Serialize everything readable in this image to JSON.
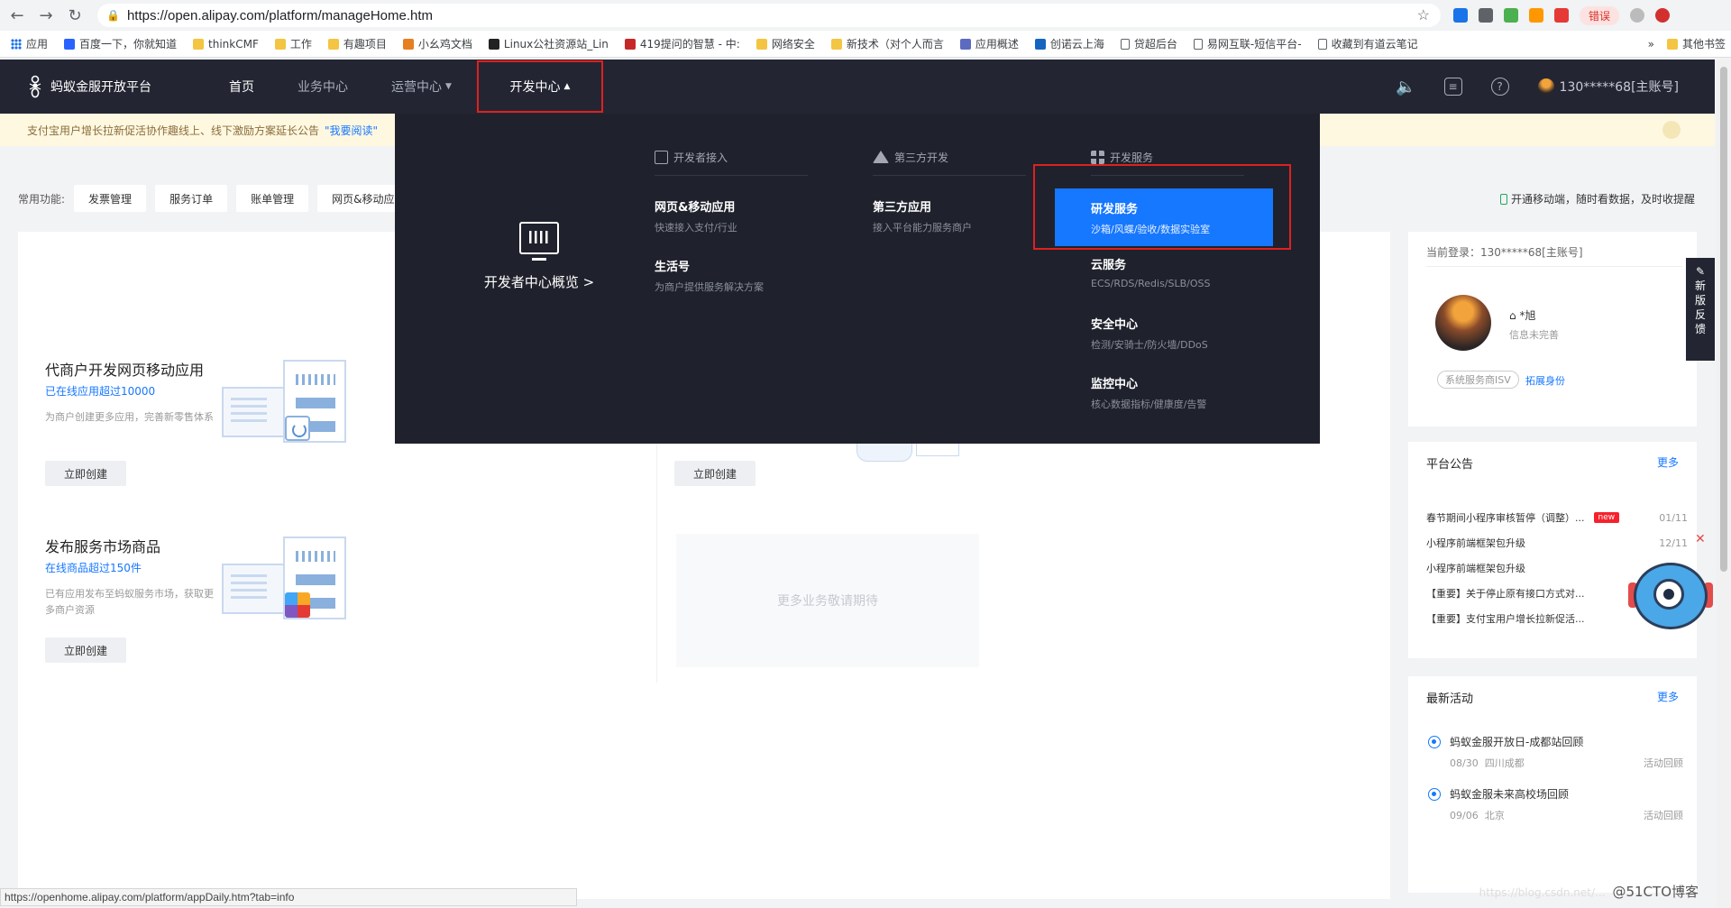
{
  "browser": {
    "url": "https://open.alipay.com/platform/manageHome.htm",
    "bookmarks": [
      "应用",
      "百度一下，你就知道",
      "thinkCMF",
      "工作",
      "有趣项目",
      "小幺鸡文档",
      "Linux公社资源站_Lin",
      "419提问的智慧 - 中:",
      "网络安全",
      "新技术（对个人而言",
      "应用概述",
      "创诺云上海",
      "贷超后台",
      "易网互联-短信平台-",
      "收藏到有道云笔记"
    ],
    "more_bookmarks": "其他书签",
    "error_badge": "错误",
    "status_url": "https://openhome.alipay.com/platform/appDaily.htm?tab=info"
  },
  "header": {
    "logo_text": "蚂蚁金服开放平台",
    "nav": [
      "首页",
      "业务中心",
      "运营中心",
      "开发中心"
    ],
    "account": "130*****68[主账号]"
  },
  "notice": {
    "text": "支付宝用户增长拉新促活协作趣线上、线下激励方案延长公告",
    "link": "\"我要阅读\""
  },
  "quick": {
    "label": "常用功能:",
    "items": [
      "发票管理",
      "服务订单",
      "账单管理",
      "网页&移动应用开"
    ]
  },
  "mobile_tip": "开通移动端，随时看数据，及时收提醒",
  "biz": [
    {
      "title": "代商户开发网页移动应用",
      "sub": "已在线应用超过10000",
      "desc": "为商户创建更多应用，完善新零售体系",
      "btn": "立即创建"
    },
    {
      "title": "发布服务市场商品",
      "sub": "在线商品超过150件",
      "desc": "已有应用发布至蚂蚁服务市场，获取更多商户资源",
      "btn": "立即创建"
    }
  ],
  "middle_btn": "立即创建",
  "coming_soon": "更多业务敬请期待",
  "user": {
    "login": "当前登录：130*****68[主账号]",
    "name": "*旭",
    "info": "信息未完善",
    "tag": "系统服务商ISV",
    "expand": "拓展身份"
  },
  "announce": {
    "title": "平台公告",
    "more": "更多",
    "items": [
      {
        "text": "春节期间小程序审核暂停（调整）...",
        "new": "new",
        "date": "01/11"
      },
      {
        "text": "小程序前端框架包升级",
        "new": "",
        "date": "12/11"
      },
      {
        "text": "小程序前端框架包升级",
        "new": "",
        "date": ""
      },
      {
        "text": "【重要】关于停止原有接口方式对...",
        "new": "",
        "date": ""
      },
      {
        "text": "【重要】支付宝用户增长拉新促活...",
        "new": "",
        "date": ""
      }
    ]
  },
  "activity": {
    "title": "最新活动",
    "more": "更多",
    "items": [
      {
        "title": "蚂蚁金服开放日-成都站回顾",
        "date": "08/30",
        "place": "四川成都",
        "tag": "活动回顾"
      },
      {
        "title": "蚂蚁金服未来高校场回顾",
        "date": "09/06",
        "place": "北京",
        "tag": "活动回顾"
      }
    ]
  },
  "feedback": [
    "新",
    "版",
    "反",
    "馈"
  ],
  "dev_menu": {
    "overview": "开发者中心概览 >",
    "columns": [
      {
        "head": "开发者接入",
        "items": [
          {
            "t": "网页&移动应用",
            "s": "快速接入支付/行业"
          },
          {
            "t": "生活号",
            "s": "为商户提供服务解决方案"
          }
        ]
      },
      {
        "head": "第三方开发",
        "items": [
          {
            "t": "第三方应用",
            "s": "接入平台能力服务商户"
          }
        ]
      },
      {
        "head": "开发服务",
        "items": [
          {
            "t": "研发服务",
            "s": "沙箱/风蝶/验收/数据实验室"
          },
          {
            "t": "云服务",
            "s": "ECS/RDS/Redis/SLB/OSS"
          },
          {
            "t": "安全中心",
            "s": "检测/安骑士/防火墙/DDoS"
          },
          {
            "t": "监控中心",
            "s": "核心数据指标/健康度/告警"
          }
        ]
      }
    ]
  },
  "watermark": "@51CTO博客",
  "watermark_faint": "https://blog.csdn.net/..."
}
